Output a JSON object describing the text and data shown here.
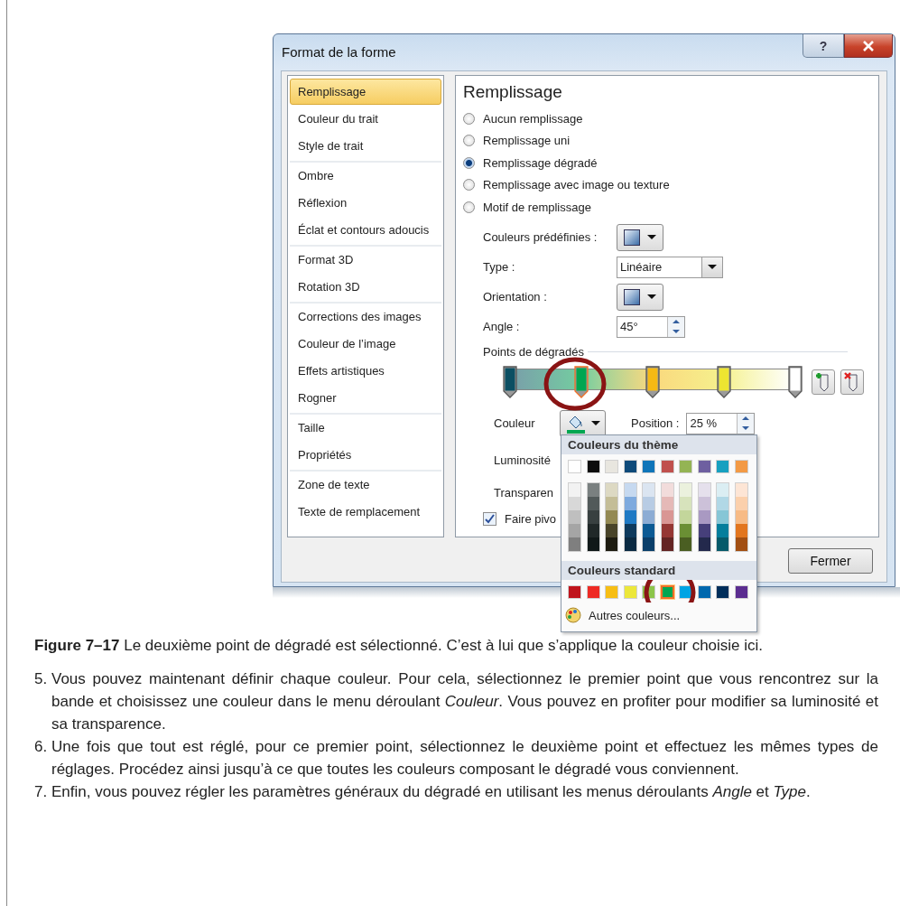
{
  "window": {
    "title": "Format de la forme",
    "help": "?"
  },
  "sidebar": {
    "groups": [
      {
        "items": [
          {
            "label": "Remplissage",
            "selected": true
          },
          {
            "label": "Couleur du trait",
            "selected": false
          },
          {
            "label": "Style de trait",
            "selected": false
          }
        ]
      },
      {
        "items": [
          {
            "label": "Ombre",
            "selected": false
          },
          {
            "label": "Réflexion",
            "selected": false
          },
          {
            "label": "Éclat et contours adoucis",
            "selected": false
          }
        ]
      },
      {
        "items": [
          {
            "label": "Format 3D",
            "selected": false
          },
          {
            "label": "Rotation 3D",
            "selected": false
          }
        ]
      },
      {
        "items": [
          {
            "label": "Corrections des images",
            "selected": false
          },
          {
            "label": "Couleur de l’image",
            "selected": false
          },
          {
            "label": "Effets artistiques",
            "selected": false
          },
          {
            "label": "Rogner",
            "selected": false
          }
        ]
      },
      {
        "items": [
          {
            "label": "Taille",
            "selected": false
          },
          {
            "label": "Propriétés",
            "selected": false
          }
        ]
      },
      {
        "items": [
          {
            "label": "Zone de texte",
            "selected": false
          },
          {
            "label": "Texte de remplacement",
            "selected": false
          }
        ]
      }
    ]
  },
  "panel": {
    "heading": "Remplissage",
    "fill_options": [
      {
        "label": "Aucun remplissage",
        "selected": false
      },
      {
        "label": "Remplissage uni",
        "selected": false
      },
      {
        "label": "Remplissage dégradé",
        "selected": true
      },
      {
        "label": "Remplissage avec image ou texture",
        "selected": false
      },
      {
        "label": "Motif de remplissage",
        "selected": false
      }
    ],
    "preset_label": "Couleurs prédéfinies :",
    "type_label": "Type :",
    "type_value": "Linéaire",
    "orientation_label": "Orientation :",
    "angle_label": "Angle :",
    "angle_value": "45°",
    "stops_label": "Points de dégradés",
    "stops": [
      {
        "color": "#0b4f63",
        "level": 0,
        "selected": false
      },
      {
        "color": "#00a651",
        "level": 0.25,
        "selected": true
      },
      {
        "color": "#f5b914",
        "level": 0.5,
        "selected": false
      },
      {
        "color": "#ede531",
        "level": 0.75,
        "selected": false
      },
      {
        "color": "#ffffff",
        "level": 1,
        "selected": false
      }
    ],
    "color_label": "Couleur",
    "position_label": "Position :",
    "position_value": "25 %",
    "brightness_label": "Luminosité",
    "transparency_label": "Transparen",
    "rotate": {
      "label": "Faire pivo",
      "checked": true
    },
    "close_button": "Fermer"
  },
  "color_menu": {
    "theme_heading": "Couleurs du thème",
    "theme": [
      {
        "color": "#ffffff",
        "shades": [
          {
            "color": "#f2f2f2"
          },
          {
            "color": "#d8d8d8"
          },
          {
            "color": "#bfbfbf"
          },
          {
            "color": "#a5a5a5"
          },
          {
            "color": "#7f7f7f"
          }
        ]
      },
      {
        "color": "#0d0d0d",
        "shades": [
          {
            "color": "#7a8080"
          },
          {
            "color": "#525a5a"
          },
          {
            "color": "#384040"
          },
          {
            "color": "#202828"
          },
          {
            "color": "#101818"
          }
        ]
      },
      {
        "color": "#e8e6df",
        "shades": [
          {
            "color": "#ddd9c3"
          },
          {
            "color": "#c4bd97"
          },
          {
            "color": "#938953"
          },
          {
            "color": "#494429"
          },
          {
            "color": "#1d1b10"
          }
        ]
      },
      {
        "color": "#0e4a7a",
        "shades": [
          {
            "color": "#c6d9f0"
          },
          {
            "color": "#7eaade"
          },
          {
            "color": "#1f7ac4"
          },
          {
            "color": "#0e3a5d"
          },
          {
            "color": "#0a2a42"
          }
        ]
      },
      {
        "color": "#0f75b9",
        "shades": [
          {
            "color": "#dbe5f1"
          },
          {
            "color": "#b8cce4"
          },
          {
            "color": "#8cacd4"
          },
          {
            "color": "#0b5a94"
          },
          {
            "color": "#0a3f6a"
          }
        ]
      },
      {
        "color": "#c0504d",
        "shades": [
          {
            "color": "#f2dcdb"
          },
          {
            "color": "#e5b9b7"
          },
          {
            "color": "#d99694"
          },
          {
            "color": "#953734"
          },
          {
            "color": "#632423"
          }
        ]
      },
      {
        "color": "#94b454",
        "shades": [
          {
            "color": "#ebf1dd"
          },
          {
            "color": "#d7e3bc"
          },
          {
            "color": "#c3d69b"
          },
          {
            "color": "#6a8f34"
          },
          {
            "color": "#4a5e22"
          }
        ]
      },
      {
        "color": "#6e5fa0",
        "shades": [
          {
            "color": "#e5e0ec"
          },
          {
            "color": "#ccc1d9"
          },
          {
            "color": "#a999c2"
          },
          {
            "color": "#463f7a"
          },
          {
            "color": "#23294c"
          }
        ]
      },
      {
        "color": "#17a0c0",
        "shades": [
          {
            "color": "#dbeef3"
          },
          {
            "color": "#b1d8e6"
          },
          {
            "color": "#86c6d6"
          },
          {
            "color": "#047e9c"
          },
          {
            "color": "#065a6a"
          }
        ]
      },
      {
        "color": "#f39a45",
        "shades": [
          {
            "color": "#fde5d5"
          },
          {
            "color": "#fbd0ac"
          },
          {
            "color": "#f7bb86"
          },
          {
            "color": "#e2761f"
          },
          {
            "color": "#a24f13"
          }
        ]
      }
    ],
    "standard_heading": "Couleurs standard",
    "standard": [
      {
        "color": "#c0141c",
        "selected": false
      },
      {
        "color": "#ee2a24",
        "selected": false
      },
      {
        "color": "#f7be14",
        "selected": false
      },
      {
        "color": "#ece73a",
        "selected": false
      },
      {
        "color": "#8cc54a",
        "selected": false
      },
      {
        "color": "#00a651",
        "selected": true
      },
      {
        "color": "#00a4e4",
        "selected": false
      },
      {
        "color": "#0068ae",
        "selected": false
      },
      {
        "color": "#002e5a",
        "selected": false
      },
      {
        "color": "#5b2d90",
        "selected": false
      }
    ],
    "more_colors": "Autres couleurs..."
  },
  "caption": "**Figure 7–17**  Le deuxième point de dégradé est sélectionné. C’est à lui que s’applique la couleur choisie ici.",
  "steps": [
    {
      "number": "5.",
      "text": "Vous pouvez maintenant définir chaque couleur. Pour cela, sélectionnez le premier point que vous rencontrez sur la bande et choisissez une couleur dans le menu déroulant *Couleur*. Vous pouvez en profiter pour modifier sa luminosité et sa transparence."
    },
    {
      "number": "6.",
      "text": "Une fois que tout est réglé, pour ce premier point, sélectionnez le deuxième point et effectuez les mêmes types de réglages. Procédez ainsi jusqu’à ce que toutes les couleurs composant le dégradé vous conviennent."
    },
    {
      "number": "7.",
      "text": "Enfin, vous pouvez régler les paramètres généraux du dégradé en utilisant les menus déroulants *Angle* et *Type*."
    }
  ]
}
